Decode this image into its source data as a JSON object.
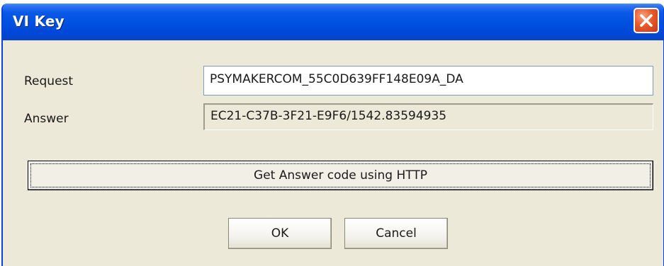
{
  "window": {
    "title": "VI Key"
  },
  "titlebar": {
    "close_icon": "close-icon"
  },
  "form": {
    "request_label": "Request",
    "request_value": "PSYMAKERCOM_55C0D639FF148E09A_DA",
    "answer_label": "Answer",
    "answer_value": "EC21-C37B-3F21-E9F6/1542.83594935"
  },
  "buttons": {
    "http_label": "Get Answer code using HTTP",
    "ok_label": "OK",
    "cancel_label": "Cancel"
  },
  "colors": {
    "titlebar_blue": "#0050e0",
    "close_red": "#e85a2a",
    "dialog_bg": "#ece9d8"
  }
}
